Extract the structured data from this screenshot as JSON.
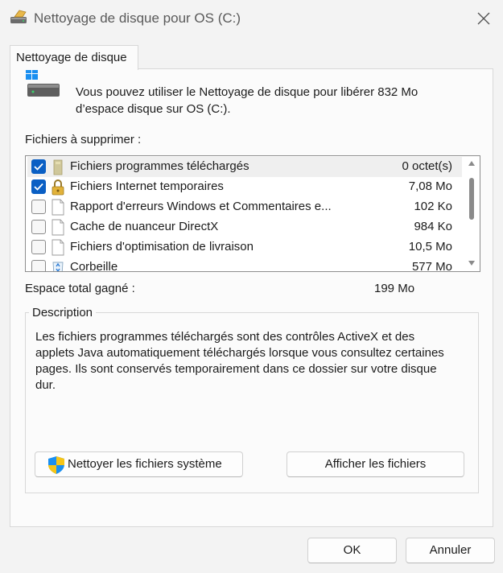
{
  "window": {
    "title": "Nettoyage de disque pour OS (C:)"
  },
  "tab": {
    "label": "Nettoyage de disque"
  },
  "info_text": "Vous pouvez utiliser le Nettoyage de disque pour libérer 832 Mo d’espace disque sur OS (C:).",
  "files_label": "Fichiers à supprimer :",
  "files": [
    {
      "name": "Fichiers programmes téléchargés",
      "size": "0 octet(s)",
      "checked": true,
      "icon": "folder-icon"
    },
    {
      "name": "Fichiers Internet temporaires",
      "size": "7,08 Mo",
      "checked": true,
      "icon": "lock-icon"
    },
    {
      "name": "Rapport d'erreurs Windows et Commentaires e...",
      "size": "102 Ko",
      "checked": false,
      "icon": "document-icon"
    },
    {
      "name": "Cache de nuanceur DirectX",
      "size": "984 Ko",
      "checked": false,
      "icon": "document-icon"
    },
    {
      "name": "Fichiers d'optimisation de livraison",
      "size": "10,5 Mo",
      "checked": false,
      "icon": "document-icon"
    },
    {
      "name": "Corbeille",
      "size": "577 Mo",
      "checked": false,
      "icon": "recycle-bin-icon"
    }
  ],
  "total": {
    "label": "Espace total gagné :",
    "value": "199 Mo"
  },
  "description": {
    "legend": "Description",
    "text": "Les fichiers programmes téléchargés sont des contrôles ActiveX et des applets Java automatiquement téléchargés lorsque vous consultez certaines pages. Ils sont conservés temporairement dans ce dossier sur votre disque dur."
  },
  "buttons": {
    "clean_system": "Nettoyer les fichiers système",
    "view_files": "Afficher les fichiers",
    "ok": "OK",
    "cancel": "Annuler"
  },
  "colors": {
    "accent": "#0a5fc4",
    "background": "#f3f3f3",
    "panel": "#fbfbfb"
  }
}
